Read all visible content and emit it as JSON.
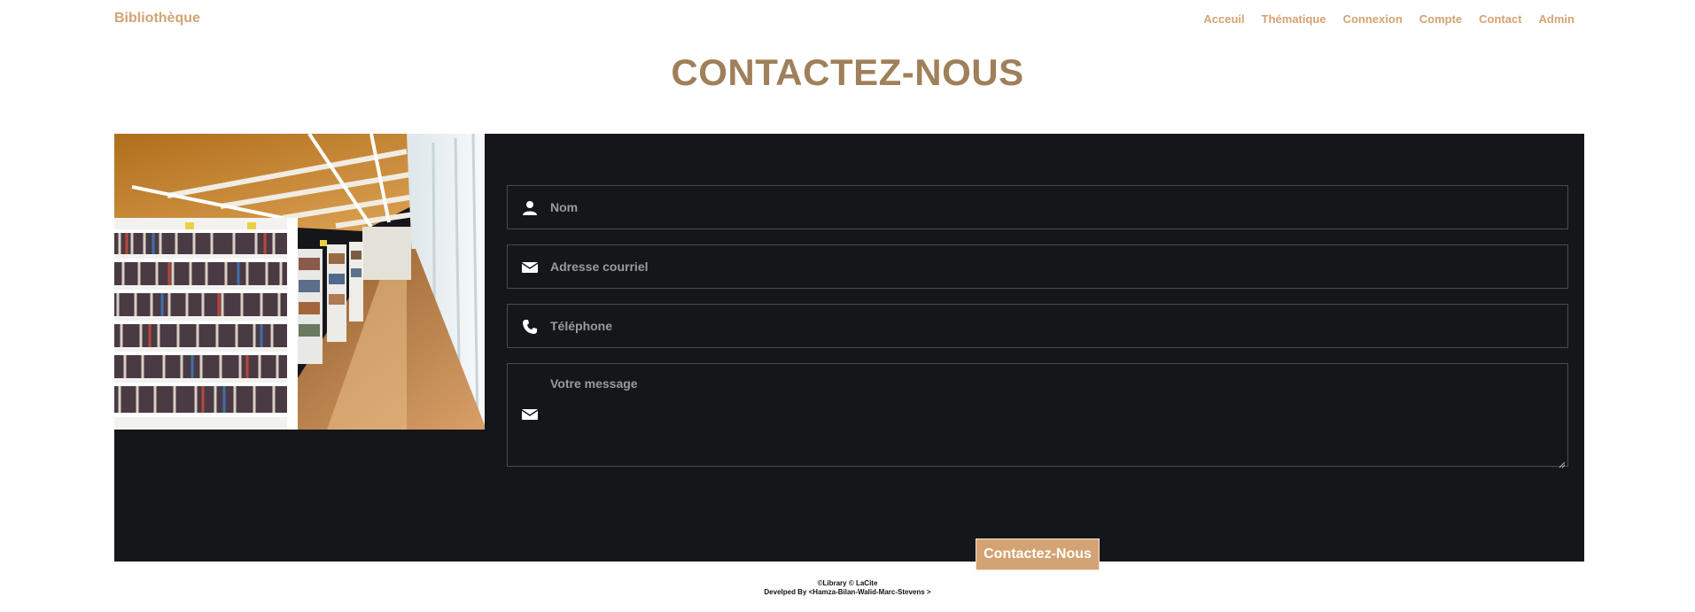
{
  "nav": {
    "brand": "Bibliothèque",
    "links": [
      "Acceuil",
      "Thématique",
      "Connexion",
      "Compte",
      "Contact",
      "Admin"
    ]
  },
  "page": {
    "title": "CONTACTEZ-NOUS"
  },
  "form": {
    "name_placeholder": "Nom",
    "email_placeholder": "Adresse courriel",
    "phone_placeholder": "Téléphone",
    "message_placeholder": "Votre message",
    "submit_label": "Contactez-Nous",
    "icons": {
      "name": "user-icon",
      "email": "envelope-icon",
      "phone": "phone-icon",
      "message": "envelope-icon"
    }
  },
  "footer": {
    "line1": "©Library © LaCite",
    "line2": "Develped By <Hamza-Bilan-Walid-Marc-Stevens >"
  },
  "colors": {
    "accent": "#d4a373",
    "title": "#a0805a",
    "panel": "#15161a"
  }
}
